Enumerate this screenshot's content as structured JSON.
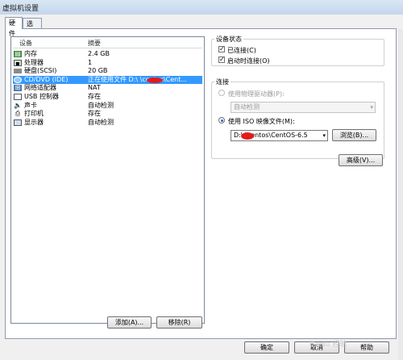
{
  "window": {
    "title": "虚拟机设置"
  },
  "tabs": [
    {
      "label": "硬件"
    },
    {
      "label": "选项"
    }
  ],
  "device_list": {
    "headers": {
      "device": "设备",
      "summary": "摘要"
    },
    "rows": [
      {
        "icon": "memory-icon",
        "name": "内存",
        "summary": "2.4 GB"
      },
      {
        "icon": "cpu-icon",
        "name": "处理器",
        "summary": "1"
      },
      {
        "icon": "harddisk-icon",
        "name": "硬盘(SCSI)",
        "summary": "20 GB"
      },
      {
        "icon": "cdrom-icon",
        "name": "CD/DVD (IDE)",
        "summary": "正在使用文件 D:\\      \\centos\\Cent..."
      },
      {
        "icon": "network-icon",
        "name": "网络适配器",
        "summary": "NAT"
      },
      {
        "icon": "usb-icon",
        "name": "USB 控制器",
        "summary": "存在"
      },
      {
        "icon": "sound-icon",
        "name": "声卡",
        "summary": "自动检测"
      },
      {
        "icon": "printer-icon",
        "name": "打印机",
        "summary": "存在"
      },
      {
        "icon": "display-icon",
        "name": "显示器",
        "summary": "自动检测"
      }
    ],
    "selected_index": 3
  },
  "list_buttons": {
    "add": "添加(A)...",
    "remove": "移除(R)"
  },
  "device_status": {
    "title": "设备状态",
    "connected": {
      "label": "已连接(C)",
      "checked": true
    },
    "connect_on_power": {
      "label": "启动时连接(O)",
      "checked": true
    }
  },
  "connection": {
    "title": "连接",
    "physical": {
      "label": "使用物理驱动器(P):",
      "selected": false,
      "combo_value": "自动检测"
    },
    "iso": {
      "label": "使用 ISO 映像文件(M):",
      "selected": true,
      "path": "D:\\      \\centos\\CentOS-6.5",
      "browse": "浏览(B)..."
    }
  },
  "advanced_button": "高级(V)...",
  "footer": {
    "ok": "确定",
    "cancel": "取消",
    "help": "帮助"
  },
  "watermark": "Baidu 经验"
}
